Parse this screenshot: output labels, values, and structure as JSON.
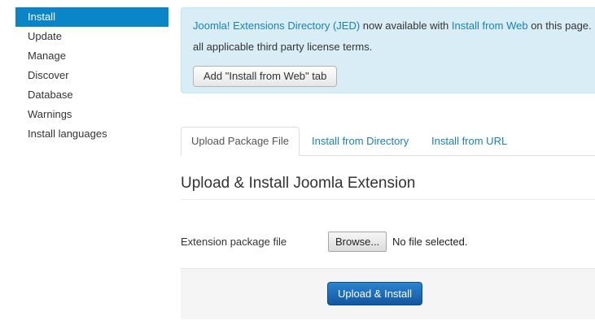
{
  "sidebar": {
    "items": [
      {
        "label": "Install",
        "active": true
      },
      {
        "label": "Update"
      },
      {
        "label": "Manage"
      },
      {
        "label": "Discover"
      },
      {
        "label": "Database"
      },
      {
        "label": "Warnings"
      },
      {
        "label": "Install languages"
      }
    ]
  },
  "alert": {
    "jed_link": "Joomla! Extensions Directory (JED)",
    "text_middle": " now available with ",
    "install_web_link": "Install from Web",
    "text_end": " on this page.",
    "line2": "all applicable third party license terms.",
    "button_label": "Add \"Install from Web\" tab"
  },
  "tabs": [
    {
      "label": "Upload Package File",
      "active": true
    },
    {
      "label": "Install from Directory"
    },
    {
      "label": "Install from URL"
    }
  ],
  "form": {
    "title": "Upload & Install Joomla Extension",
    "file_label": "Extension package file",
    "browse_label": "Browse...",
    "file_status": "No file selected.",
    "submit_label": "Upload & Install"
  },
  "colors": {
    "accent": "#0a85c7",
    "link": "#1a80b6",
    "alert_bg": "#d9edf7",
    "primary_button": "#1a6bb5"
  }
}
